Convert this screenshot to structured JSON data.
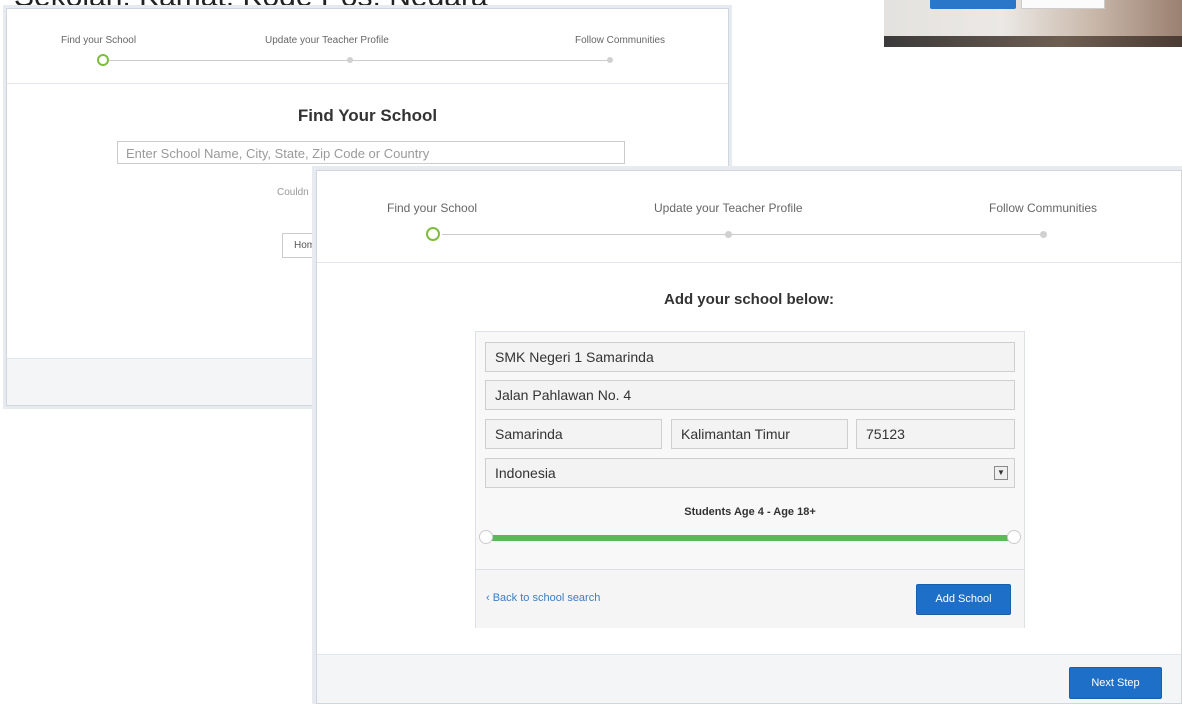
{
  "top_caption": "Sekolah, Kamat, Kode Pos, Negara",
  "back_panel": {
    "steps": [
      "Find your School",
      "Update your Teacher Profile",
      "Follow Communities"
    ],
    "title": "Find Your School",
    "search_placeholder": "Enter School Name, City, State, Zip Code or Country",
    "could_text": "Couldn",
    "home_button": "Hom"
  },
  "front_panel": {
    "steps": [
      "Find your School",
      "Update your Teacher Profile",
      "Follow Communities"
    ],
    "heading": "Add your school below:",
    "form": {
      "school_name": "SMK Negeri 1 Samarinda",
      "address": "Jalan Pahlawan No. 4",
      "city": "Samarinda",
      "state": "Kalimantan Timur",
      "zip": "75123",
      "country": "Indonesia"
    },
    "age_range_label": "Students Age 4 - Age 18+",
    "age_range_fill_fraction": 1.0,
    "back_link": "‹ Back to school search",
    "add_school_button": "Add School",
    "next_step_button": "Next Step"
  },
  "colors": {
    "accent_green": "#7dbe3c",
    "slider_green": "#5cb85c",
    "primary_blue": "#1e6fc8",
    "link_blue": "#3b7dc4"
  },
  "icons": {
    "select_arrow": "dropdown-arrow-icon"
  }
}
